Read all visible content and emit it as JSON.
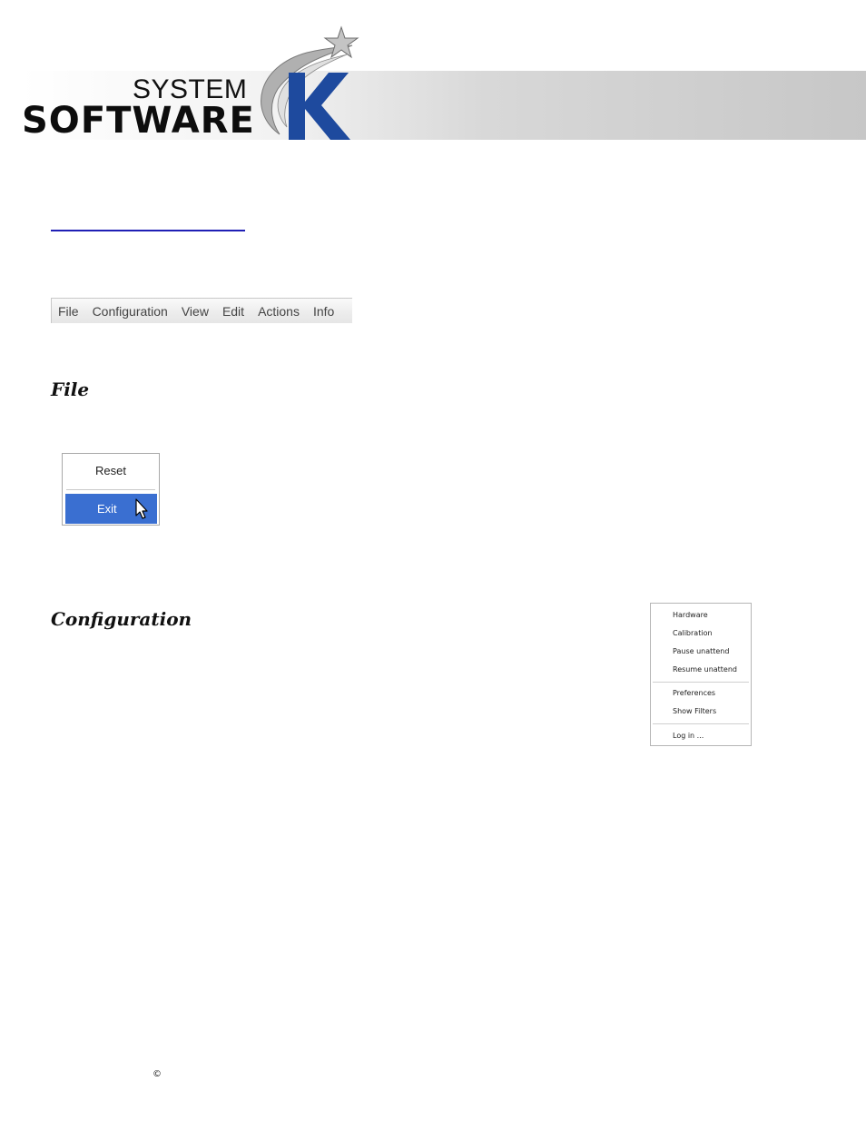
{
  "header": {
    "logo_system": "SYSTEM",
    "logo_software": "SOFTWARE",
    "logo_letter": "K"
  },
  "menubar": {
    "items": [
      "File",
      "Configuration",
      "View",
      "Edit",
      "Actions",
      "Info"
    ]
  },
  "sections": {
    "file_heading": "File",
    "config_heading": "Configuration"
  },
  "file_menu": {
    "items": [
      "Reset",
      "Exit"
    ],
    "highlighted": "Exit",
    "highlight_color": "#3a6fd1"
  },
  "config_menu": {
    "items": [
      "Hardware",
      "Calibration",
      "Pause unattend",
      "Resume unattend",
      "Preferences",
      "Show Filters",
      "Log in ..."
    ]
  },
  "footer": {
    "copyright": "©"
  },
  "colors": {
    "brand_blue": "#1e4a9e",
    "link": "#1f1fb5"
  }
}
